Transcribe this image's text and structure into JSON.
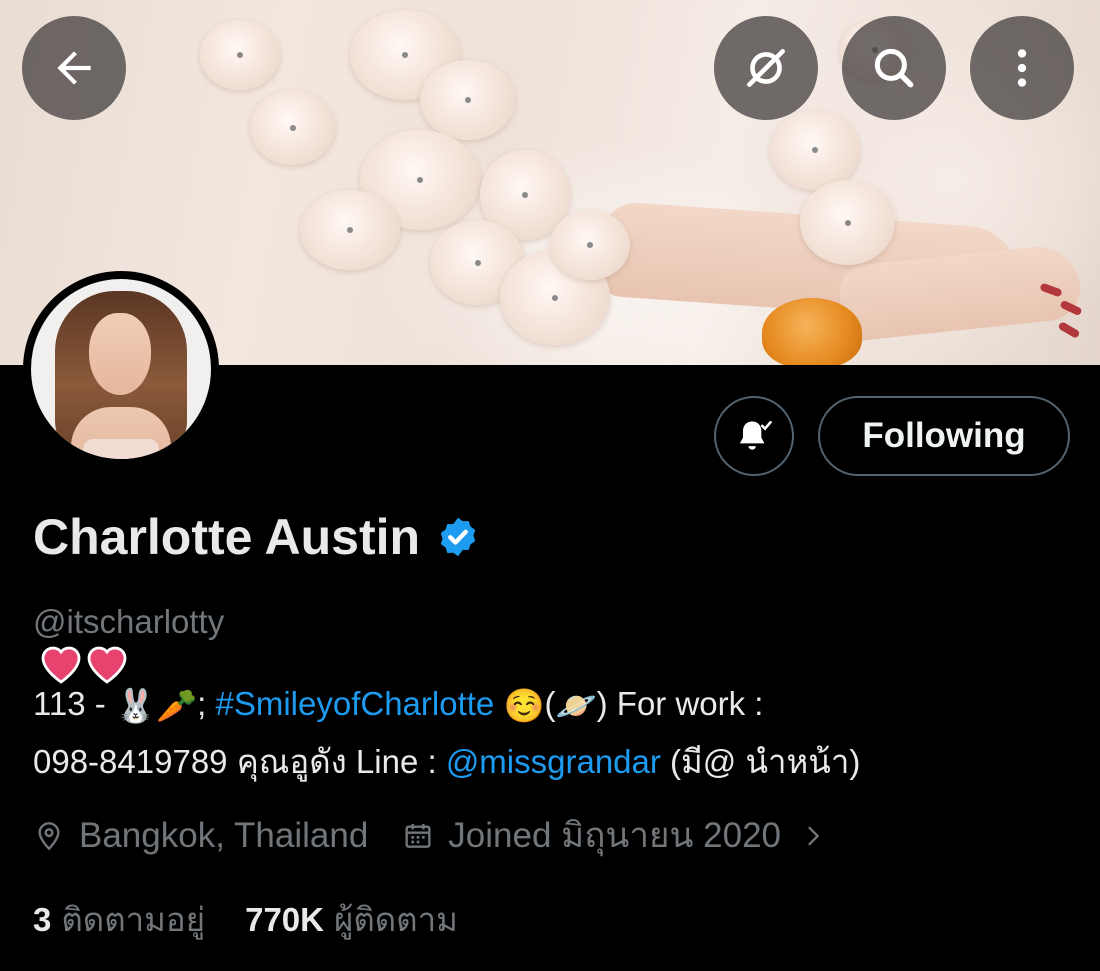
{
  "header": {
    "back_icon": "back-arrow-icon",
    "grok_icon": "grok-icon",
    "search_icon": "search-icon",
    "more_icon": "more-vertical-icon"
  },
  "profile": {
    "display_name": "Charlotte Austin",
    "verified": true,
    "handle": "@itscharlotty",
    "notification_icon": "bell-check-icon",
    "follow_label": "Following"
  },
  "bio": {
    "decoration": "hearts",
    "part1": "113 - ",
    "emoji1": "🐰",
    "emoji2": "🥕",
    "part2": "; ",
    "hashtag": "#SmileyofCharlotte",
    "emoji3": "☺️",
    "part3_open": "(",
    "emoji4": "🪐",
    "part3_close": ") For work :",
    "line2_text": "098-8419789 คุณอูดัง Line : ",
    "mention": "@missgrandar",
    "line2_suffix": " (มี@ นำหน้า)"
  },
  "meta": {
    "location_icon": "location-pin-icon",
    "location": "Bangkok, Thailand",
    "calendar_icon": "calendar-icon",
    "joined": "Joined มิถุนายน 2020",
    "chevron_icon": "chevron-right-icon"
  },
  "stats": {
    "following_count": "3",
    "following_label": "ติดตามอยู่",
    "followers_count": "770K",
    "followers_label": "ผู้ติดตาม"
  },
  "colors": {
    "background": "#000000",
    "accent": "#1d9bf0",
    "secondary_text": "#71767b",
    "primary_text": "#e7e9ea",
    "heart": "#e0245e"
  }
}
